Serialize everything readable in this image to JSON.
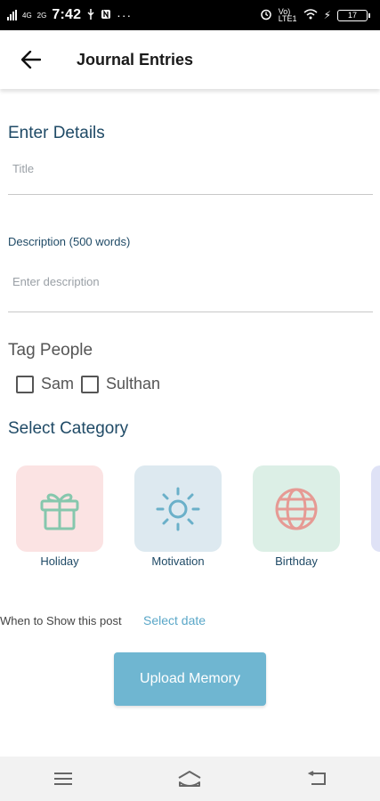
{
  "status_bar": {
    "network_left": "4G",
    "network_right": "2G",
    "time": "7:42",
    "volte_top": "Vo)",
    "volte_bottom": "LTE1",
    "battery_level": "17"
  },
  "app_bar": {
    "back_icon": "arrow-left-icon",
    "title": "Journal Entries"
  },
  "form": {
    "details_title": "Enter Details",
    "title_placeholder": "Title",
    "description_label": "Description (500 words)",
    "description_placeholder": "Enter description"
  },
  "tags": {
    "title": "Tag People",
    "people": [
      {
        "name": "Sam",
        "checked": false
      },
      {
        "name": "Sulthan",
        "checked": false
      }
    ]
  },
  "category": {
    "title": "Select Category",
    "items": [
      {
        "label": "Holiday",
        "icon": "gift-icon",
        "bg": "#fbe3e3",
        "icon_color": "#86c7ad"
      },
      {
        "label": "Motivation",
        "icon": "sun-icon",
        "bg": "#dde9f0",
        "icon_color": "#6ab0c9"
      },
      {
        "label": "Birthday",
        "icon": "globe-icon",
        "bg": "#dcefe6",
        "icon_color": "#e69a94"
      },
      {
        "label": "",
        "icon": "",
        "bg": "#dfe2f6",
        "icon_color": ""
      }
    ]
  },
  "schedule": {
    "when_label": "When to Show this post",
    "select_date": "Select date"
  },
  "actions": {
    "upload_label": "Upload Memory"
  },
  "colors": {
    "accent": "#6fb6d1",
    "heading": "#1f4a66"
  }
}
